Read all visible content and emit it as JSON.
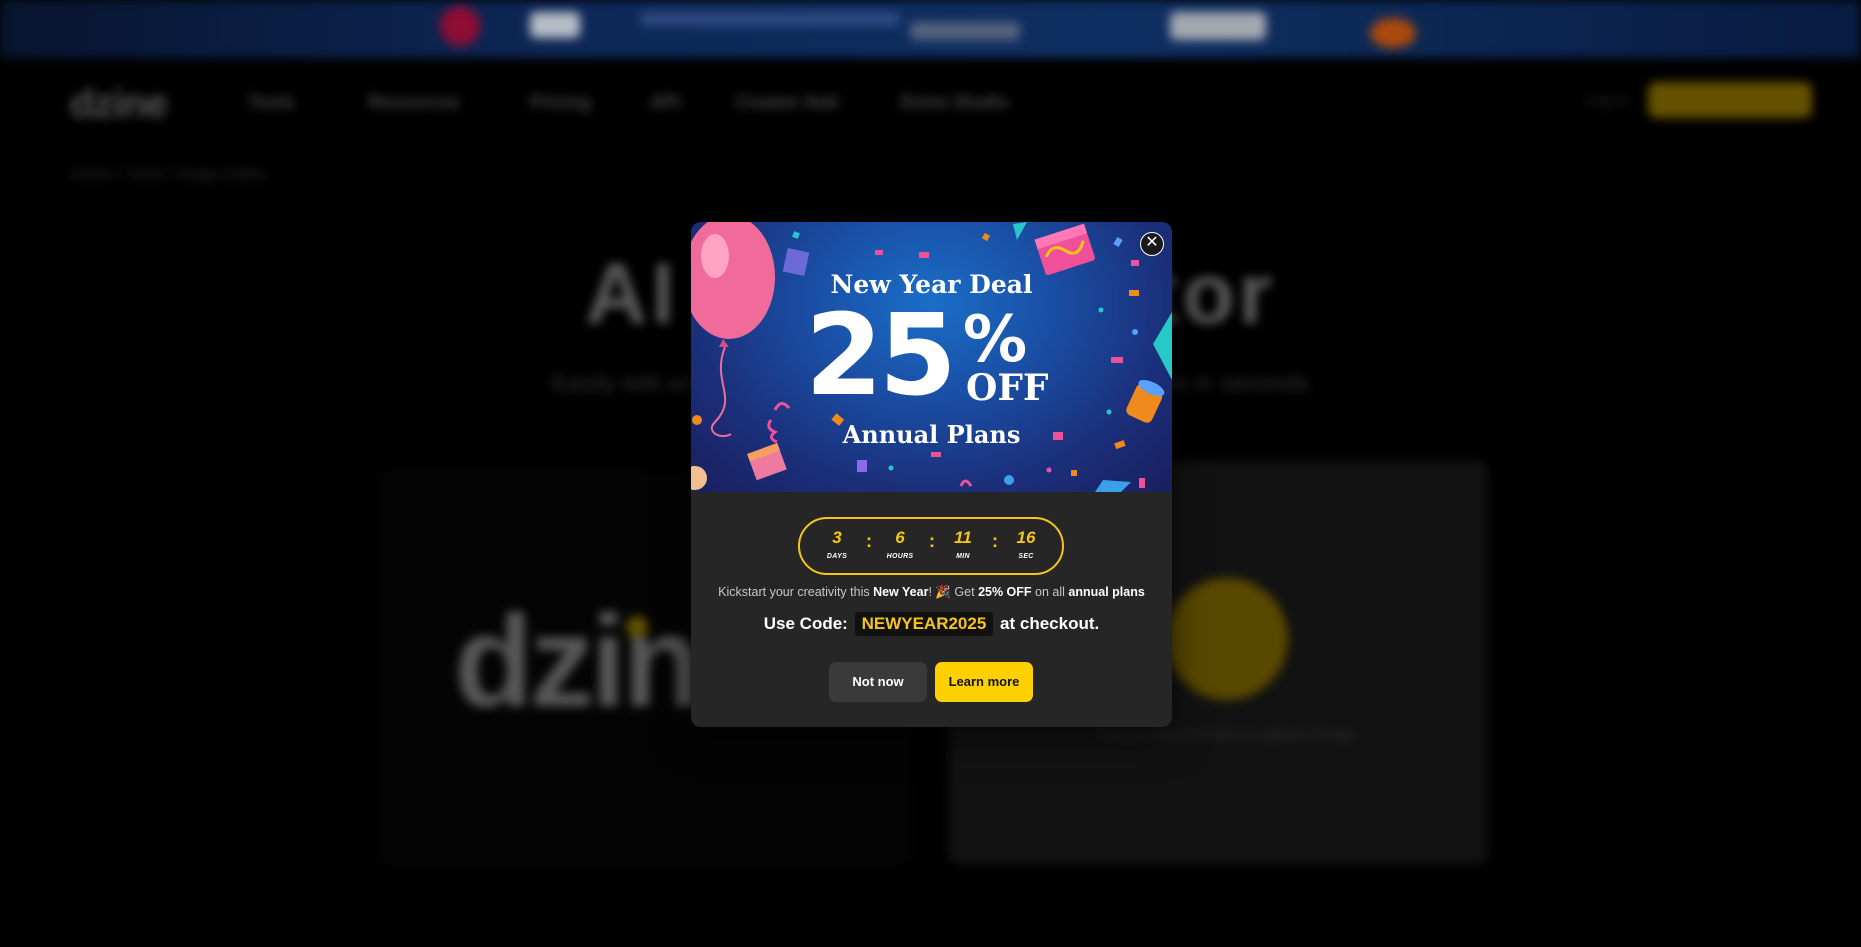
{
  "modal": {
    "banner": {
      "title": "New Year Deal",
      "discount_number": "25",
      "percent_sign": "%",
      "off_label": "OFF",
      "subtitle": "Annual Plans"
    },
    "countdown": {
      "days": "3",
      "days_label": "DAYS",
      "hours": "6",
      "hours_label": "HOURS",
      "minutes": "11",
      "minutes_label": "MIN",
      "seconds": "16",
      "seconds_label": "SEC",
      "separator": ":"
    },
    "message": {
      "part1": "Kickstart your creativity this ",
      "bold1": "New Year",
      "part2": "! 🎉 Get ",
      "bold2": "25% OFF",
      "part3": " on all ",
      "bold3": "annual plans"
    },
    "code_line": {
      "prefix": "Use Code:",
      "code": "NEWYEAR2025",
      "suffix": "at checkout."
    },
    "buttons": {
      "not_now": "Not now",
      "learn_more": "Learn more",
      "close_glyph": "✕"
    },
    "colors": {
      "accent": "#ffd000",
      "countdown_border": "#f5c518",
      "modal_bg": "#262626"
    }
  },
  "background": {
    "logo": "dzine",
    "nav_items": [
      "Tools",
      "Resources",
      "Pricing",
      "API",
      "Creator Hub",
      "Dzine Studio"
    ],
    "login": "Log in",
    "breadcrumb": "Home  /  Tools  /  Image Editor",
    "hero_title": "AI Image Editor",
    "hero_subtitle": "Easily edit and transform your images with AI-powered tools in seconds",
    "panel_wordmark": "dzine",
    "panel_caption": "Drag & drop or click to upload image"
  }
}
